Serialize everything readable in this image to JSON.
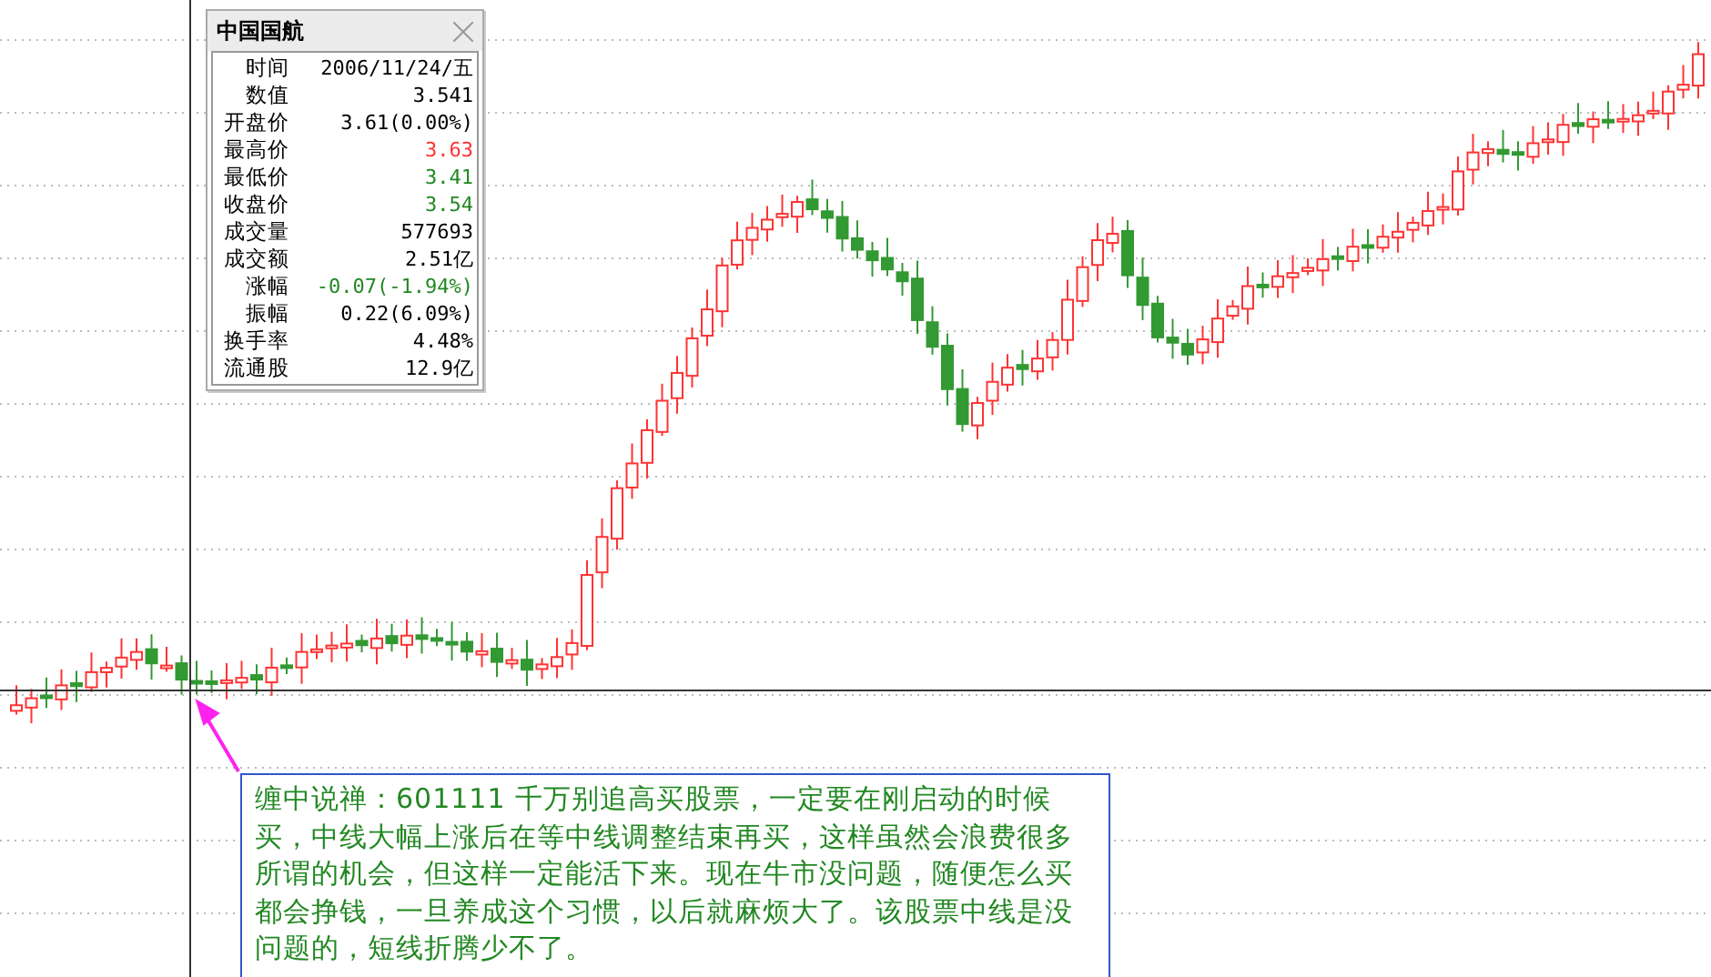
{
  "quote_window": {
    "title": "中国国航",
    "rows": [
      {
        "label": "时间",
        "value": "2006/11/24/五",
        "color": "#000000"
      },
      {
        "label": "数值",
        "value": "3.541",
        "color": "#000000"
      },
      {
        "label": "开盘价",
        "value": "3.61(0.00%)",
        "color": "#000000"
      },
      {
        "label": "最高价",
        "value": "3.63",
        "color": "#ff3333"
      },
      {
        "label": "最低价",
        "value": "3.41",
        "color": "#228822"
      },
      {
        "label": "收盘价",
        "value": "3.54",
        "color": "#228822"
      },
      {
        "label": "成交量",
        "value": "577693",
        "color": "#000000"
      },
      {
        "label": "成交额",
        "value": "2.51亿",
        "color": "#000000"
      },
      {
        "label": "涨幅",
        "value": "-0.07(-1.94%)",
        "color": "#228822"
      },
      {
        "label": "振幅",
        "value": "0.22(6.09%)",
        "color": "#000000"
      },
      {
        "label": "换手率",
        "value": "4.48%",
        "color": "#000000"
      },
      {
        "label": "流通股",
        "value": "12.9亿",
        "color": "#000000"
      }
    ]
  },
  "annotation": {
    "text": "缠中说禅：601111 千万别追高买股票，一定要在刚启动的时候买，中线大幅上涨后在等中线调整结束再买，这样虽然会浪费很多所谓的机会，但这样一定能活下来。现在牛市没问题，随便怎么买都会挣钱，一旦养成这个习惯，以后就麻烦大了。该股票中线是没问题的，短线折腾少不了。"
  }
}
